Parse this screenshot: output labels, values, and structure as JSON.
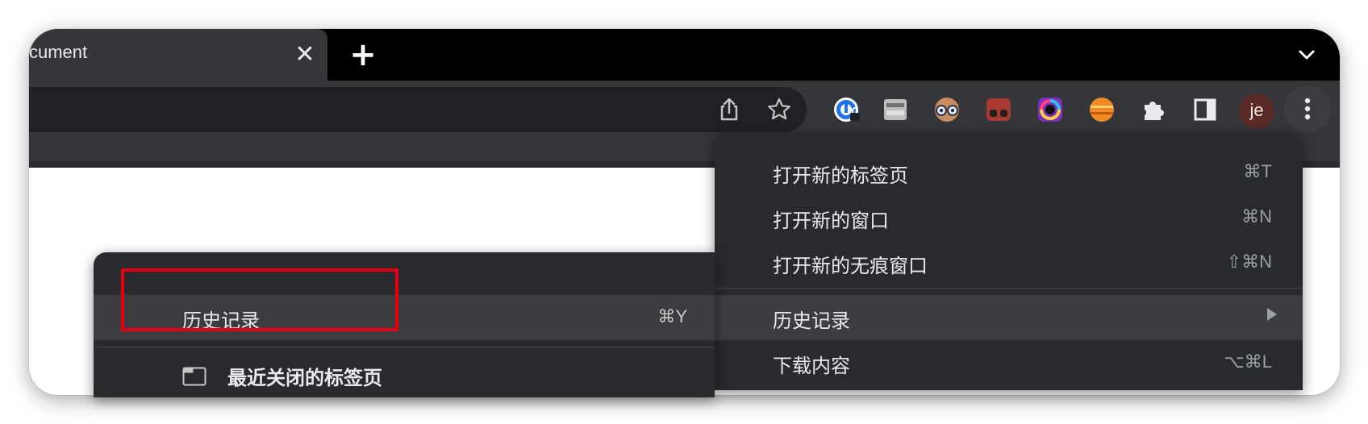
{
  "tab": {
    "title": "cument",
    "close_glyph": "✕",
    "new_tab_glyph": "+"
  },
  "toolbar": {
    "icons": [
      "share-icon",
      "bookmark-star-icon",
      "password-manager-extension-icon",
      "reader-extension-icon",
      "glasses-extension-icon",
      "red-extension-icon",
      "color-ring-extension-icon",
      "orange-planet-extension-icon",
      "extensions-puzzle-icon",
      "side-panel-icon"
    ],
    "avatar_initials": "je"
  },
  "main_menu": {
    "items": [
      {
        "label": "打开新的标签页",
        "shortcut": "⌘T"
      },
      {
        "label": "打开新的窗口",
        "shortcut": "⌘N"
      },
      {
        "label": "打开新的无痕窗口",
        "shortcut": "⇧⌘N"
      },
      {
        "label": "历史记录",
        "shortcut": "",
        "submenu": true,
        "highlighted": true
      },
      {
        "label": "下载内容",
        "shortcut": "⌥⌘L"
      }
    ]
  },
  "history_submenu": {
    "items": [
      {
        "label": "历史记录",
        "shortcut": "⌘Y",
        "highlighted": true
      },
      {
        "label": "最近关闭的标签页",
        "icon": "tab-window-icon"
      }
    ]
  },
  "colors": {
    "tab_strip": "#000000",
    "toolbar": "#35363a",
    "menu_bg": "#292a2d",
    "menu_highlight": "#3c3d40",
    "annotation_red": "#e60012"
  }
}
